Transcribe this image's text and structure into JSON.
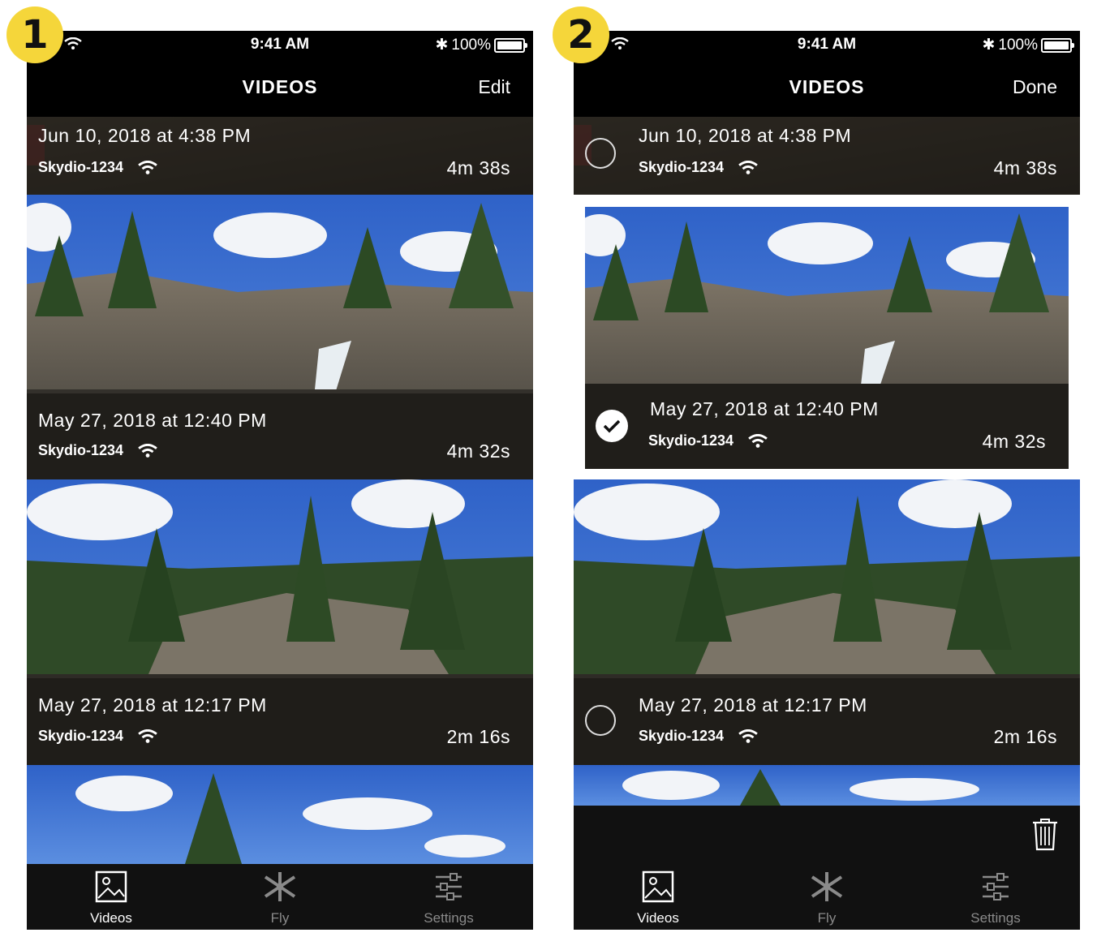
{
  "badges": [
    "1",
    "2"
  ],
  "status": {
    "time": "9:41 AM",
    "battery": "100%"
  },
  "screen1": {
    "title": "VIDEOS",
    "action": "Edit",
    "videos": [
      {
        "date": "Jun 10, 2018 at 4:38 PM",
        "device": "Skydio-1234",
        "duration": "4m 38s"
      },
      {
        "date": "May 27, 2018 at 12:40 PM",
        "device": "Skydio-1234",
        "duration": "4m 32s"
      },
      {
        "date": "May 27, 2018 at 12:17 PM",
        "device": "Skydio-1234",
        "duration": "2m 16s"
      }
    ]
  },
  "screen2": {
    "title": "VIDEOS",
    "action": "Done",
    "videos": [
      {
        "date": "Jun 10, 2018 at 4:38 PM",
        "device": "Skydio-1234",
        "duration": "4m 38s",
        "selected": false
      },
      {
        "date": "May 27, 2018 at 12:40 PM",
        "device": "Skydio-1234",
        "duration": "4m 32s",
        "selected": true
      },
      {
        "date": "May 27, 2018 at 12:17 PM",
        "device": "Skydio-1234",
        "duration": "2m 16s",
        "selected": false
      }
    ],
    "toolbar_icon": "trash-icon"
  },
  "tabs": [
    {
      "label": "Videos",
      "icon": "gallery-icon",
      "active": true
    },
    {
      "label": "Fly",
      "icon": "drone-icon",
      "active": false
    },
    {
      "label": "Settings",
      "icon": "sliders-icon",
      "active": false
    }
  ],
  "colors": {
    "badge": "#f5d63a",
    "bar": "#000000",
    "tabbar": "#111111",
    "inactive": "#8a8a8a"
  }
}
